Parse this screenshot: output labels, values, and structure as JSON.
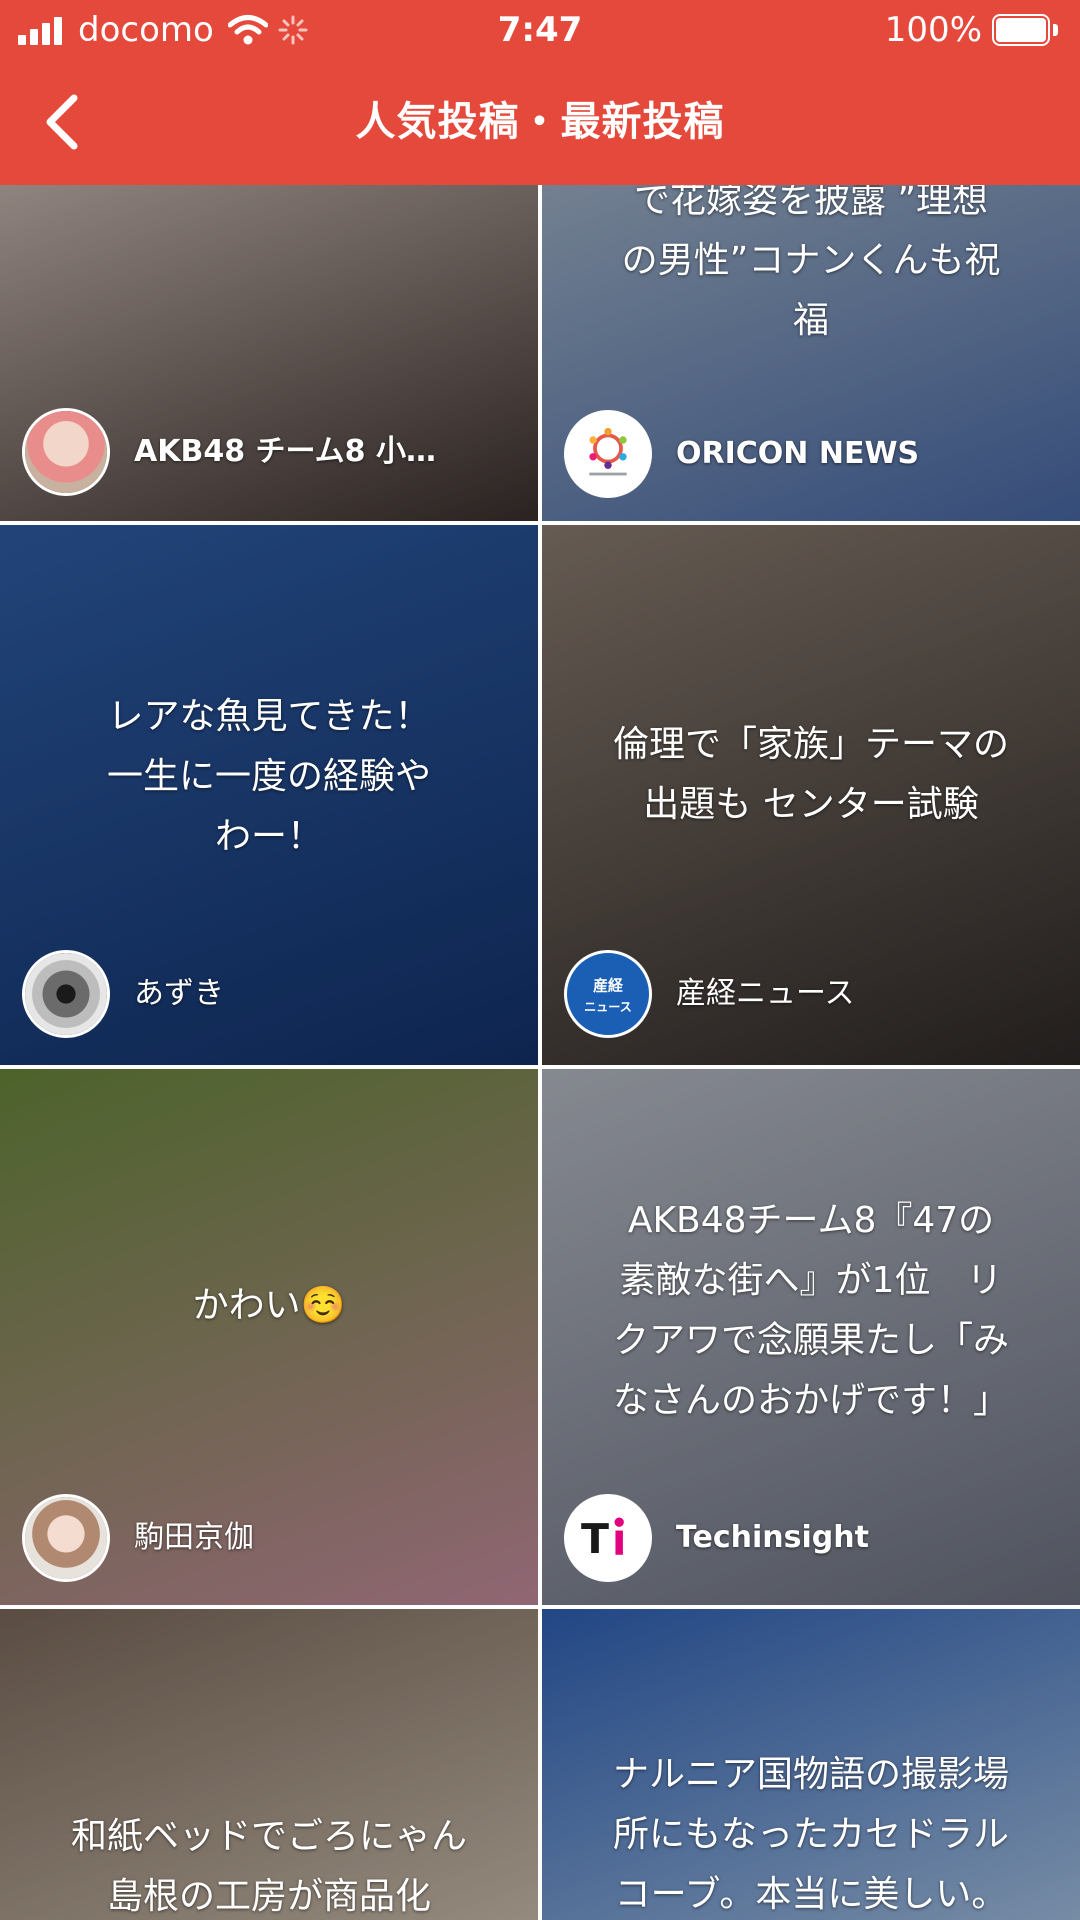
{
  "status_bar": {
    "carrier": "docomo",
    "time": "7:47",
    "battery": "100%"
  },
  "nav": {
    "title": "人気投稿・最新投稿"
  },
  "cards": [
    {
      "text": "",
      "author": "AKB48 チーム8 小…",
      "avatar_icon": "member-photo-avatar",
      "colors": [
        "#c7b7b0",
        "#3b302d"
      ]
    },
    {
      "text": "で花嫁姿を披露 ”理想\nの男性”コナンくんも祝\n福",
      "author": "ORICON NEWS",
      "avatar_icon": "oricon-news-logo",
      "colors": [
        "#9fb2c8",
        "#4a6aa8"
      ]
    },
    {
      "text": "レアな魚見てきた！\n一生に一度の経験や\nわー！",
      "author": "あずき",
      "avatar_icon": "speaker-photo-avatar",
      "colors": [
        "#2f5fa8",
        "#13336e"
      ]
    },
    {
      "text": "倫理で「家族」テーマの\n出題も センター試験",
      "author": "産経ニュース",
      "avatar_icon": "sankei-news-logo",
      "colors": [
        "#8d7f73",
        "#2f2a28"
      ]
    },
    {
      "text": "かわい☺️",
      "author": "駒田京伽",
      "avatar_icon": "member-photo-avatar",
      "colors": [
        "#6a8a3c",
        "#c88ea0"
      ]
    },
    {
      "text": "AKB48チーム8『47の\n素敵な街へ』が1位　リ\nクアワで念願果たし「み\nなさんのおかげです！」",
      "author": "Techinsight",
      "avatar_icon": "techinsight-logo",
      "colors": [
        "#b9bec8",
        "#6f7484"
      ]
    },
    {
      "text": "和紙ベッドでごろにゃん\n島根の工房が商品化",
      "author": "",
      "avatar_icon": "",
      "colors": [
        "#7d6a5c",
        "#cfc1b0"
      ]
    },
    {
      "text": "ナルニア国物語の撮影場\n所にもなったカセドラル\nコーブ。本当に美しい。",
      "author": "",
      "avatar_icon": "",
      "colors": [
        "#2f62b8",
        "#a7c4e6"
      ]
    }
  ]
}
